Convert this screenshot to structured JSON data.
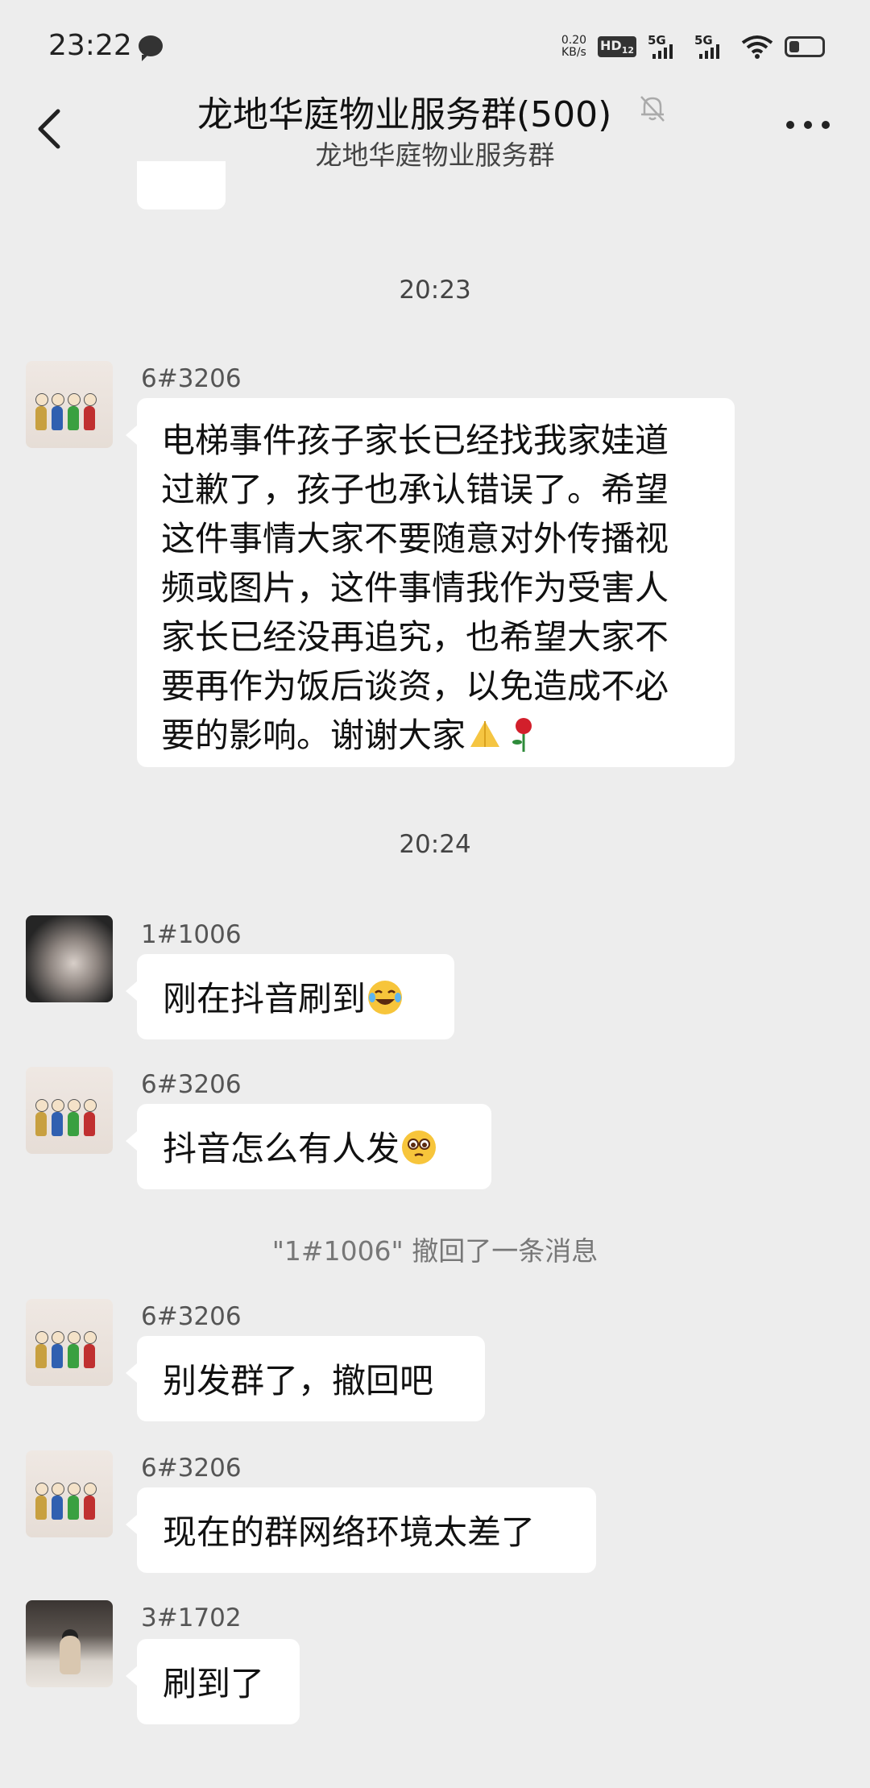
{
  "status_bar": {
    "time": "23:22",
    "net_speed_value": "0.20",
    "net_speed_unit": "KB/s",
    "hd": "HD",
    "hd_sub": "12",
    "signal1": "5G",
    "signal2": "5G"
  },
  "header": {
    "title": "龙地华庭物业服务群(500)",
    "subtitle": "龙地华庭物业服务群"
  },
  "messages": {
    "time1": "20:23",
    "m1": {
      "sender": "6#3206",
      "lines": [
        "电梯事件孩子家长已经找我家娃道",
        "过歉了，孩子也承认错误了。希望",
        "这件事情大家不要随意对外传播视",
        "频或图片，这件事情我作为受害人",
        "家长已经没再追究，也希望大家不",
        "要再作为饭后谈资，以免造成不必",
        "要的影响。谢谢大家"
      ],
      "emojis": [
        "pray-emoji",
        "rose-emoji"
      ]
    },
    "time2": "20:24",
    "m2": {
      "sender": "1#1006",
      "text": "刚在抖音刷到",
      "emoji": "laughing-tears-emoji"
    },
    "m3": {
      "sender": "6#3206",
      "text": "抖音怎么有人发",
      "emoji": "pleading-face-emoji"
    },
    "system": "\"1#1006\" 撤回了一条消息",
    "m4": {
      "sender": "6#3206",
      "text": "别发群了，撤回吧"
    },
    "m5": {
      "sender": "6#3206",
      "text": "现在的群网络环境太差了"
    },
    "m6": {
      "sender": "3#1702",
      "text": "刷到了"
    }
  },
  "colors": {
    "background": "#ededed",
    "bubble": "#ffffff",
    "time_text": "#444444",
    "system_text": "#777777"
  }
}
